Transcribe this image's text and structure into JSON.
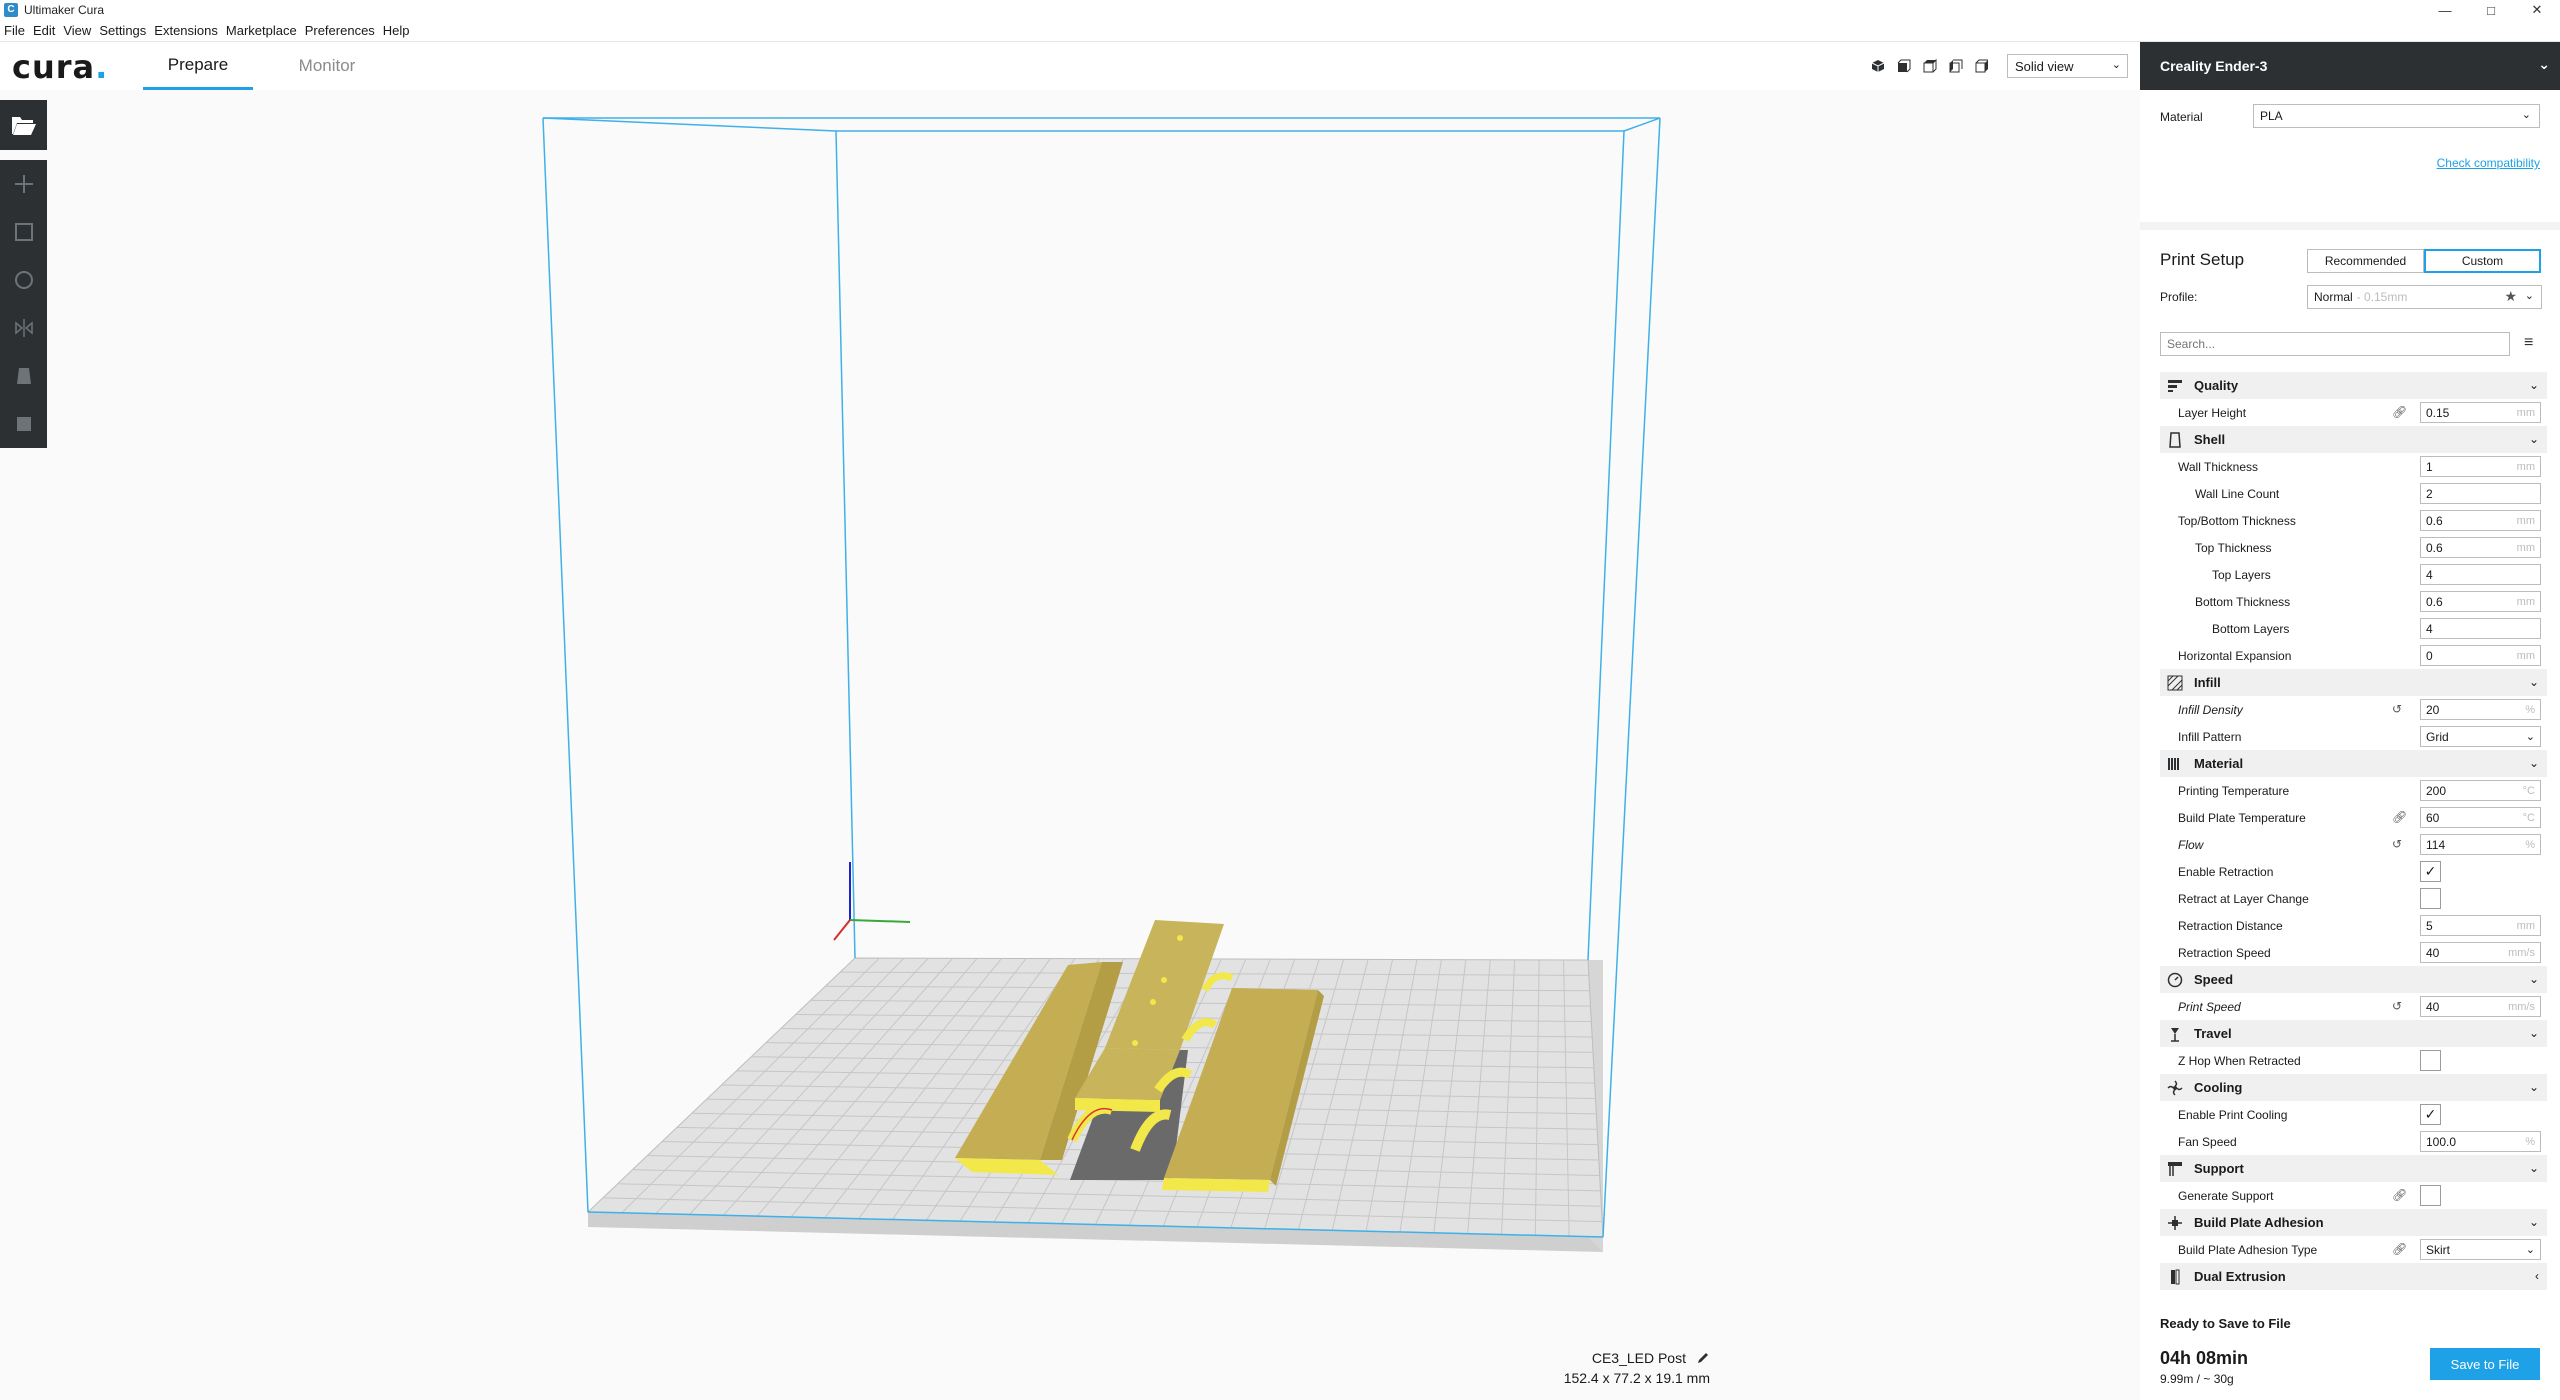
{
  "window": {
    "title": "Ultimaker Cura"
  },
  "menu": [
    "File",
    "Edit",
    "View",
    "Settings",
    "Extensions",
    "Marketplace",
    "Preferences",
    "Help"
  ],
  "header": {
    "logo": "cura",
    "tabs": {
      "prepare": "Prepare",
      "monitor": "Monitor"
    },
    "view_mode": "Solid view"
  },
  "object": {
    "name": "CE3_LED Post",
    "dimensions": "152.4 x 77.2 x 19.1 mm"
  },
  "printer": {
    "name": "Creality Ender-3"
  },
  "material": {
    "label": "Material",
    "value": "PLA",
    "check_link": "Check compatibility"
  },
  "print_setup": {
    "title": "Print Setup",
    "modes": {
      "recommended": "Recommended",
      "custom": "Custom"
    },
    "profile_label": "Profile:",
    "profile_value": "Normal",
    "profile_sub": "- 0.15mm",
    "search_placeholder": "Search..."
  },
  "categories": {
    "quality": "Quality",
    "shell": "Shell",
    "infill": "Infill",
    "material": "Material",
    "speed": "Speed",
    "travel": "Travel",
    "cooling": "Cooling",
    "support": "Support",
    "adhesion": "Build Plate Adhesion",
    "dual": "Dual Extrusion"
  },
  "settings": {
    "layer_height": {
      "label": "Layer Height",
      "value": "0.15",
      "unit": "mm"
    },
    "wall_thickness": {
      "label": "Wall Thickness",
      "value": "1",
      "unit": "mm"
    },
    "wall_line_count": {
      "label": "Wall Line Count",
      "value": "2"
    },
    "top_bottom_thickness": {
      "label": "Top/Bottom Thickness",
      "value": "0.6",
      "unit": "mm"
    },
    "top_thickness": {
      "label": "Top Thickness",
      "value": "0.6",
      "unit": "mm"
    },
    "top_layers": {
      "label": "Top Layers",
      "value": "4"
    },
    "bottom_thickness": {
      "label": "Bottom Thickness",
      "value": "0.6",
      "unit": "mm"
    },
    "bottom_layers": {
      "label": "Bottom Layers",
      "value": "4"
    },
    "horizontal_expansion": {
      "label": "Horizontal Expansion",
      "value": "0",
      "unit": "mm"
    },
    "infill_density": {
      "label": "Infill Density",
      "value": "20",
      "unit": "%"
    },
    "infill_pattern": {
      "label": "Infill Pattern",
      "value": "Grid"
    },
    "printing_temperature": {
      "label": "Printing Temperature",
      "value": "200",
      "unit": "°C"
    },
    "build_plate_temperature": {
      "label": "Build Plate Temperature",
      "value": "60",
      "unit": "°C"
    },
    "flow": {
      "label": "Flow",
      "value": "114",
      "unit": "%"
    },
    "enable_retraction": {
      "label": "Enable Retraction",
      "checked": true
    },
    "retract_layer_change": {
      "label": "Retract at Layer Change",
      "checked": false
    },
    "retraction_distance": {
      "label": "Retraction Distance",
      "value": "5",
      "unit": "mm"
    },
    "retraction_speed": {
      "label": "Retraction Speed",
      "value": "40",
      "unit": "mm/s"
    },
    "print_speed": {
      "label": "Print Speed",
      "value": "40",
      "unit": "mm/s"
    },
    "z_hop": {
      "label": "Z Hop When Retracted",
      "checked": false
    },
    "enable_cooling": {
      "label": "Enable Print Cooling",
      "checked": true
    },
    "fan_speed": {
      "label": "Fan Speed",
      "value": "100.0",
      "unit": "%"
    },
    "generate_support": {
      "label": "Generate Support",
      "checked": false
    },
    "adhesion_type": {
      "label": "Build Plate Adhesion Type",
      "value": "Skirt"
    }
  },
  "action": {
    "status": "Ready to Save to File",
    "time": "04h 08min",
    "material_usage": "9.99m / ~ 30g",
    "save_label": "Save to File"
  },
  "colors": {
    "accent": "#1ea1e6",
    "dark": "#2c3033",
    "model": "#c8b45a",
    "model_top": "#f2e84a"
  }
}
